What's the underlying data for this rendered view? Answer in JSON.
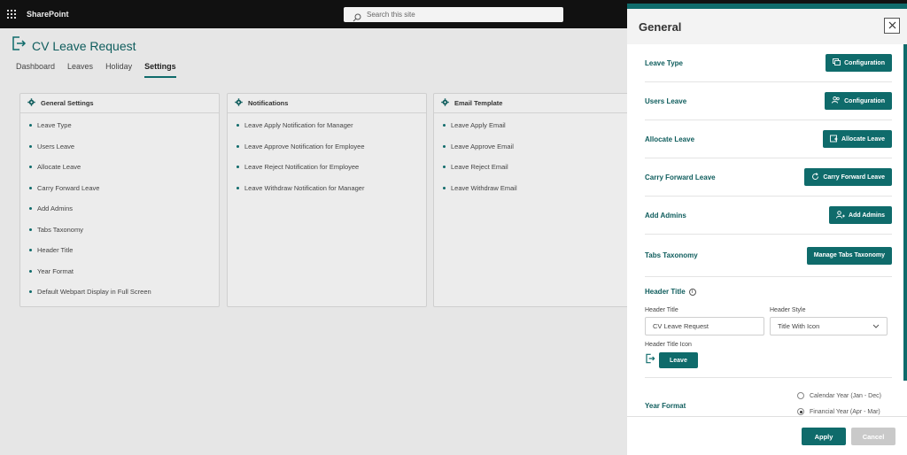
{
  "suite": {
    "title": "SharePoint",
    "search_placeholder": "Search this site"
  },
  "app": {
    "title": "CV Leave Request"
  },
  "tabs": [
    {
      "label": "Dashboard"
    },
    {
      "label": "Leaves"
    },
    {
      "label": "Holiday"
    },
    {
      "label": "Settings",
      "active": true
    }
  ],
  "cards": [
    {
      "title": "General Settings",
      "items": [
        "Leave Type",
        "Users Leave",
        "Allocate Leave",
        "Carry Forward Leave",
        "Add Admins",
        "Tabs Taxonomy",
        "Header Title",
        "Year Format",
        "Default Webpart Display in Full Screen"
      ]
    },
    {
      "title": "Notifications",
      "items": [
        "Leave Apply Notification for Manager",
        "Leave Approve Notification for Employee",
        "Leave Reject Notification for Employee",
        "Leave Withdraw Notification for Manager"
      ]
    },
    {
      "title": "Email Template",
      "items": [
        "Leave Apply Email",
        "Leave Approve Email",
        "Leave Reject Email",
        "Leave Withdraw Email"
      ]
    }
  ],
  "panel": {
    "title": "General",
    "rows": [
      {
        "label": "Leave Type",
        "button": "Configuration",
        "icon": "config-icon"
      },
      {
        "label": "Users Leave",
        "button": "Configuration",
        "icon": "users-icon"
      },
      {
        "label": "Allocate Leave",
        "button": "Allocate Leave",
        "icon": "allocate-icon"
      },
      {
        "label": "Carry Forward Leave",
        "button": "Carry Forward Leave",
        "icon": "refresh-icon"
      },
      {
        "label": "Add Admins",
        "button": "Add Admins",
        "icon": "add-user-icon"
      },
      {
        "label": "Tabs Taxonomy",
        "button": "Manage Tabs Taxonomy",
        "icon": ""
      }
    ],
    "header_title": {
      "section_label": "Header Title",
      "title_label": "Header Title",
      "title_value": "CV Leave Request",
      "style_label": "Header Style",
      "style_value": "Title With Icon",
      "icon_label": "Header Title Icon",
      "icon_button": "Leave"
    },
    "year_format": {
      "label": "Year Format",
      "options": [
        "Calendar Year (Jan - Dec)",
        "Financial Year (Apr - Mar)"
      ],
      "selected": "Financial Year (Apr - Mar)"
    },
    "apply_label": "Apply",
    "cancel_label": "Cancel"
  },
  "colors": {
    "accent": "#0f6b6b",
    "suitebar": "#111111"
  }
}
